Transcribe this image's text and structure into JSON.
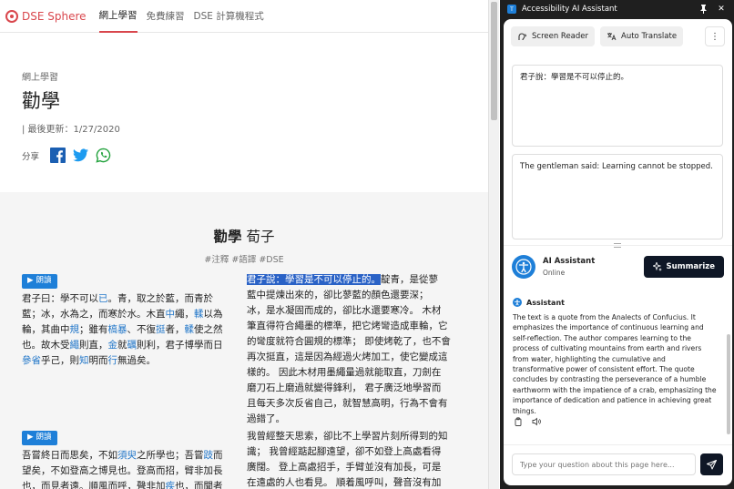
{
  "site": {
    "brand": "DSE Sphere",
    "nav": [
      "網上學習",
      "免費練習",
      "DSE 計算機程式"
    ]
  },
  "article_header": {
    "category": "網上學習",
    "title": "勸學",
    "updated": "| 最後更新：1/27/2020",
    "share_label": "分享"
  },
  "article": {
    "title_main": "勸學",
    "title_author": "荀子",
    "tags": "#注釋 #語譯 #DSE",
    "read_label": "朗讀",
    "p1_left": [
      [
        {
          "t": "君子曰：學不可以"
        },
        {
          "t": "已",
          "k": true
        },
        {
          "t": "。青，取之於藍，而青於"
        }
      ],
      [
        {
          "t": "藍；冰，水為之，而寒於水。木直"
        },
        {
          "t": "中",
          "k": true
        },
        {
          "t": "繩，"
        },
        {
          "t": "輮",
          "k": true
        },
        {
          "t": "以為"
        }
      ],
      [
        {
          "t": "輪，其曲中"
        },
        {
          "t": "規",
          "k": true
        },
        {
          "t": "；雖有"
        },
        {
          "t": "槁暴",
          "k": true
        },
        {
          "t": "、不復"
        },
        {
          "t": "挺",
          "k": true
        },
        {
          "t": "者，"
        },
        {
          "t": "輮",
          "k": true
        },
        {
          "t": "使之然"
        }
      ],
      [
        {
          "t": "也。故木受"
        },
        {
          "t": "繩",
          "k": true
        },
        {
          "t": "則直，"
        },
        {
          "t": "金",
          "k": true
        },
        {
          "t": "就"
        },
        {
          "t": "礪",
          "k": true
        },
        {
          "t": "則利，君子博學而日"
        }
      ],
      [
        {
          "t": "參省",
          "k": true
        },
        {
          "t": "乎己，則"
        },
        {
          "t": "知",
          "k": true
        },
        {
          "t": "明而"
        },
        {
          "t": "行",
          "k": true
        },
        {
          "t": "無過矣。"
        }
      ]
    ],
    "p1_right_highlight": "君子說：學習是不可以停止的。",
    "p1_right_lines": [
      "靛青，是從蓼",
      "藍中提煉出來的，卻比蓼藍的顏色還要深；",
      "冰，是水凝固而成的，卻比水還要寒冷。 木材",
      "筆直得符合繩墨的標準，把它烤彎造成車輪，它",
      "的彎度就符合圓規的標準； 即使烤乾了，也不會",
      "再次挺直，這是因為經過火烤加工，使它變成這",
      "樣的。 因此木材用墨繩量過就能取直，刀劍在",
      "磨刀石上磨過就變得鋒利， 君子廣泛地學習而",
      "且每天多次反省自己，就智慧高明，行為不會有",
      "過錯了。"
    ],
    "p2_left": [
      [
        {
          "t": "吾嘗終日而思矣，不如"
        },
        {
          "t": "須臾",
          "k": true
        },
        {
          "t": "之所學也；吾嘗"
        },
        {
          "t": "跂",
          "k": true
        },
        {
          "t": "而"
        }
      ],
      [
        {
          "t": "望矣，不如登高之博見也。登高而招，臂非加長"
        }
      ],
      [
        {
          "t": "也，而見者遠。順風而呼，聲非加"
        },
        {
          "t": "疾",
          "k": true
        },
        {
          "t": "也，而聞者"
        }
      ]
    ],
    "p2_right_lines": [
      "我曾經整天思索，卻比不上學習片刻所得到的知",
      "識； 我曾經踮起腳遠望，卻不如登上高處看得",
      "廣闊。 登上高處招手，手臂並沒有加長，可是",
      "在遠處的人也看見。 順着風呼叫，聲音沒有加"
    ]
  },
  "panel": {
    "window_title": "Accessibility AI Assistant",
    "screen_reader": "Screen Reader",
    "auto_translate": "Auto Translate",
    "source_text": "君子說：學習是不可以停止的。",
    "translated_text": "The gentleman said: Learning cannot be stopped.",
    "ai_name": "AI Assistant",
    "ai_status": "Online",
    "summarize": "Summarize",
    "msg_sender": "Assistant",
    "msg_text": "The text is a quote from the Analects of Confucius. It emphasizes the importance of continuous learning and self-reflection. The author compares learning to the process of cultivating mountains from earth and rivers from water, highlighting the cumulative and transformative power of consistent effort. The quote concludes by contrasting the perseverance of a humble earthworm with the impatience of a crab, emphasizing the importance of dedication and patience in achieving great things.",
    "input_placeholder": "Type your question about this page here..."
  },
  "colors": {
    "brand": "#d9474d",
    "link": "#2478c9",
    "highlight": "#2a62c6",
    "read_button": "#1e7fd8",
    "dark_button": "#0f1726"
  }
}
